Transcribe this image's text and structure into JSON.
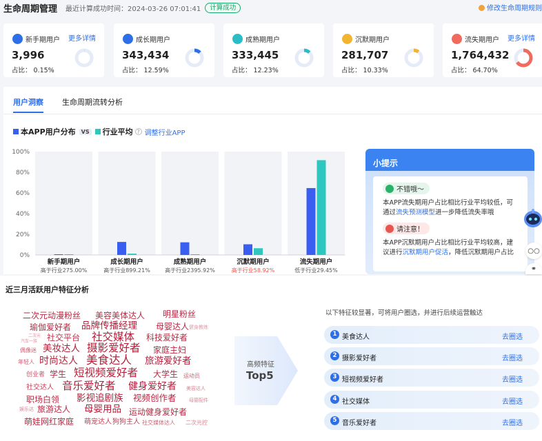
{
  "header": {
    "title": "生命周期管理",
    "calc_text": "最近计算成功时间：2024-03-26 07:01:41",
    "status_badge": "计算成功",
    "modify_link": "修改生命周期规则"
  },
  "cards": [
    {
      "label": "新手期用户",
      "value": "3,996",
      "ratio": "占比： 0.15%",
      "percent": 0.15,
      "more": "更多详情",
      "color": "#2e6fe8"
    },
    {
      "label": "成长期用户",
      "value": "343,434",
      "ratio": "占比： 12.59%",
      "percent": 12.59,
      "more": "",
      "color": "#2e6fe8"
    },
    {
      "label": "成熟期用户",
      "value": "333,445",
      "ratio": "占比： 12.23%",
      "percent": 12.23,
      "more": "",
      "color": "#2bbcc6"
    },
    {
      "label": "沉默期用户",
      "value": "281,707",
      "ratio": "占比： 10.33%",
      "percent": 10.33,
      "more": "",
      "color": "#f2b530"
    },
    {
      "label": "流失期用户",
      "value": "1,764,432",
      "ratio": "占比： 64.70%",
      "percent": 64.7,
      "more": "更多详情",
      "color": "#f06a5e"
    }
  ],
  "tabs": [
    {
      "label": "用户洞察"
    },
    {
      "label": "生命周期流转分析"
    }
  ],
  "legend": {
    "app_label": "本APP用户分布",
    "vs": "VS",
    "industry_label": "行业平均",
    "help": "?",
    "adjust_link": "调整行业APP"
  },
  "chart_data": {
    "type": "bar",
    "categories": [
      "新手期用户",
      "成长期用户",
      "成熟期用户",
      "沉默期用户",
      "流失期用户"
    ],
    "notes": [
      "高于行业275.00%",
      "高于行业899.21%",
      "高于行业2395.92%",
      "高于行业58.92%",
      "低于行业29.45%"
    ],
    "note_colors": [
      "#555555",
      "#555555",
      "#555555",
      "#e8554e",
      "#555555"
    ],
    "series": [
      {
        "name": "本APP用户分布",
        "color": "#3a5ff0",
        "values": [
          0.15,
          12.59,
          12.23,
          10.33,
          64.7
        ]
      },
      {
        "name": "行业平均",
        "color": "#2ec7c0",
        "values": [
          0.04,
          1.26,
          0.49,
          6.5,
          91.71
        ]
      }
    ],
    "yticks": [
      "0%",
      "20%",
      "40%",
      "60%",
      "80%",
      "100%"
    ],
    "ylim": [
      0,
      100
    ]
  },
  "tips": {
    "title": "小提示",
    "good_label": "不错哦～",
    "good_text_1": "本APP流失期用户占比相比行业平均较低，可",
    "good_text_2a": "通过",
    "good_link": "流失预测模型",
    "good_text_2b": "进一步降低流失率哦",
    "warn_label": "请注意！",
    "warn_text_1": "本APP沉默期用户占比相比行业平均较高，建",
    "warn_text_2a": "议进行",
    "warn_link": "沉默期用户促活",
    "warn_text_2b": "，降低沉默期用户占比"
  },
  "bottom": {
    "title": "近三月活跃用户特征分析",
    "arrow_small": "高频特征",
    "arrow_big": "Top5",
    "hint": "以下特征较显著，可将用户圈选，并进行后续运营触达",
    "features": [
      {
        "num": "1",
        "name": "美食达人",
        "action": "去圈选"
      },
      {
        "num": "2",
        "name": "摄影爱好者",
        "action": "去圈选"
      },
      {
        "num": "3",
        "name": "短视频爱好者",
        "action": "去圈选"
      },
      {
        "num": "4",
        "name": "社交媒体",
        "action": "去圈选"
      },
      {
        "num": "5",
        "name": "音乐爱好者",
        "action": "去圈选"
      }
    ],
    "cloud": [
      "二次元动漫粉丝",
      "美容美体达人",
      "明星粉丝",
      "瑜伽爱好者",
      "品牌传播经理",
      "母婴达人",
      "健身教练",
      "二次元",
      "汽车一族",
      "社交平台",
      "社交媒体",
      "科技爱好者",
      "偶像迷",
      "美妆达人",
      "摄影爱好者",
      "家庭主妇",
      "年轻人",
      "时尚达人",
      "美食达人",
      "旅游爱好者",
      "创业者",
      "学生",
      "短视频爱好者",
      "大学生",
      "运动员",
      "社交达人",
      "音乐爱好者",
      "健身爱好者",
      "美容达人",
      "职场白领",
      "影视追剧族",
      "视频创作者",
      "母婴配件",
      "娱乐达",
      "旅游达人",
      "母婴用品",
      "运动健身爱好者",
      "萌娃网红家庭",
      "萌宠达人",
      "狗狗主人",
      "社交媒体达人",
      "二次元控"
    ]
  }
}
